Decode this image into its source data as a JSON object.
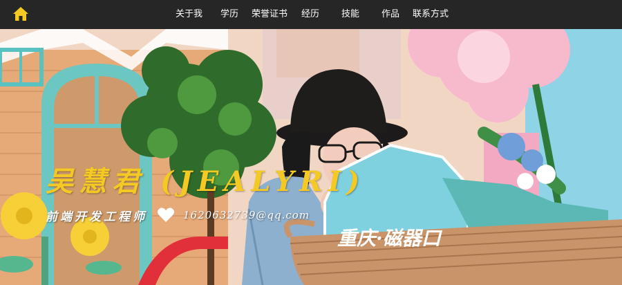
{
  "nav": {
    "home_icon": "home-icon",
    "items": [
      {
        "label": "关于我"
      },
      {
        "label": "学历"
      },
      {
        "label": "荣誉证书"
      },
      {
        "label": "经历"
      },
      {
        "label": "技能"
      },
      {
        "label": "作品"
      },
      {
        "label": "联系方式"
      }
    ]
  },
  "hero": {
    "name": "吴慧君  (JEALYRI)",
    "job_title": "前端开发工程师",
    "heart_icon": "heart-icon",
    "contact": "1620632739@qq.com",
    "sign_text": "重庆·磁器口"
  },
  "colors": {
    "navbar": "#262626",
    "home_icon": "#f5c924",
    "name": "#f5c924",
    "sub_text": "#ffffff"
  }
}
